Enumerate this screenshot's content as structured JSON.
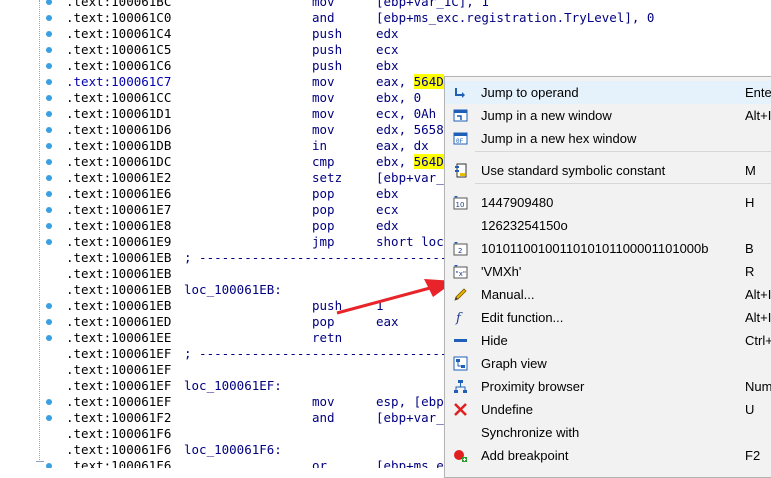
{
  "disasm": {
    "rows": [
      {
        "addr": ".text:100061BC",
        "label": "",
        "mnem": "mov",
        "ops": "[ebp+var_1C], 1",
        "dot": true
      },
      {
        "addr": ".text:100061C0",
        "label": "",
        "mnem": "and",
        "ops": "[ebp+ms_exc.registration.TryLevel], 0",
        "dot": true
      },
      {
        "addr": ".text:100061C4",
        "label": "",
        "mnem": "push",
        "ops": "edx",
        "dot": true
      },
      {
        "addr": ".text:100061C5",
        "label": "",
        "mnem": "push",
        "ops": "ecx",
        "dot": true
      },
      {
        "addr": ".text:100061C6",
        "label": "",
        "mnem": "push",
        "ops": "ebx",
        "dot": true
      },
      {
        "addr": ".text:100061C7",
        "label": "",
        "mnem": "mov",
        "ops": "eax, ",
        "hl": "564D",
        "dot": true,
        "selected": true
      },
      {
        "addr": ".text:100061CC",
        "label": "",
        "mnem": "mov",
        "ops": "ebx, 0",
        "dot": true
      },
      {
        "addr": ".text:100061D1",
        "label": "",
        "mnem": "mov",
        "ops": "ecx, 0Ah",
        "dot": true
      },
      {
        "addr": ".text:100061D6",
        "label": "",
        "mnem": "mov",
        "ops": "edx, 5658",
        "dot": true
      },
      {
        "addr": ".text:100061DB",
        "label": "",
        "mnem": "in",
        "ops": "eax, dx",
        "dot": true
      },
      {
        "addr": ".text:100061DC",
        "label": "",
        "mnem": "cmp",
        "ops": "ebx, ",
        "hl": "564D",
        "dot": true
      },
      {
        "addr": ".text:100061E2",
        "label": "",
        "mnem": "setz",
        "ops": "[ebp+var_",
        "dot": true
      },
      {
        "addr": ".text:100061E6",
        "label": "",
        "mnem": "pop",
        "ops": "ebx",
        "dot": true
      },
      {
        "addr": ".text:100061E7",
        "label": "",
        "mnem": "pop",
        "ops": "ecx",
        "dot": true
      },
      {
        "addr": ".text:100061E8",
        "label": "",
        "mnem": "pop",
        "ops": "edx",
        "dot": true
      },
      {
        "addr": ".text:100061E9",
        "label": "",
        "mnem": "jmp",
        "ops": "short loc",
        "dot": true
      },
      {
        "addr": ".text:100061EB",
        "label": "; ----------------------------------------",
        "mnem": "",
        "ops": "",
        "dot": false
      },
      {
        "addr": ".text:100061EB",
        "label": "",
        "mnem": "",
        "ops": "",
        "dot": false
      },
      {
        "addr": ".text:100061EB",
        "label": "loc_100061EB:",
        "mnem": "",
        "ops": "",
        "dot": false
      },
      {
        "addr": ".text:100061EB",
        "label": "",
        "mnem": "push",
        "ops": "1",
        "dot": true
      },
      {
        "addr": ".text:100061ED",
        "label": "",
        "mnem": "pop",
        "ops": "eax",
        "dot": true
      },
      {
        "addr": ".text:100061EE",
        "label": "",
        "mnem": "retn",
        "ops": "",
        "dot": true
      },
      {
        "addr": ".text:100061EF",
        "label": "; ----------------------------------------",
        "mnem": "",
        "ops": "",
        "dot": false
      },
      {
        "addr": ".text:100061EF",
        "label": "",
        "mnem": "",
        "ops": "",
        "dot": false
      },
      {
        "addr": ".text:100061EF",
        "label": "loc_100061EF:",
        "mnem": "",
        "ops": "",
        "dot": false
      },
      {
        "addr": ".text:100061EF",
        "label": "",
        "mnem": "mov",
        "ops": "esp, [ebp",
        "dot": true
      },
      {
        "addr": ".text:100061F2",
        "label": "",
        "mnem": "and",
        "ops": "[ebp+var_",
        "dot": true
      },
      {
        "addr": ".text:100061F6",
        "label": "",
        "mnem": "",
        "ops": "",
        "dot": false
      },
      {
        "addr": ".text:100061F6",
        "label": "loc_100061F6:",
        "mnem": "",
        "ops": "",
        "dot": false
      },
      {
        "addr": ".text:100061F6",
        "label": "",
        "mnem": "or",
        "ops": "[ebp+ms_e",
        "dot": true
      }
    ]
  },
  "context_menu": {
    "items": [
      {
        "label": "Jump to operand",
        "shortcut": "Ente",
        "icon": "jump-operand-icon"
      },
      {
        "label": "Jump in a new window",
        "shortcut": "Alt+I",
        "icon": "new-window-icon"
      },
      {
        "label": "Jump in a new hex window",
        "shortcut": "",
        "icon": "hex-window-icon"
      },
      {
        "label": "Use standard symbolic constant",
        "shortcut": "M",
        "icon": "symbolic-constant-icon"
      },
      {
        "label": "1447909480",
        "shortcut": "H",
        "icon": "decimal-icon"
      },
      {
        "label": "12623254150o",
        "shortcut": "",
        "icon": "octal-icon"
      },
      {
        "label": "1010110010011010101100001101000b",
        "shortcut": "B",
        "icon": "binary-icon"
      },
      {
        "label": "'VMXh'",
        "shortcut": "R",
        "icon": "char-icon"
      },
      {
        "label": "Manual...",
        "shortcut": "Alt+I",
        "icon": "pencil-icon"
      },
      {
        "label": "Edit function...",
        "shortcut": "Alt+I",
        "icon": "function-icon"
      },
      {
        "label": "Hide",
        "shortcut": "Ctrl+",
        "icon": "hide-icon"
      },
      {
        "label": "Graph view",
        "shortcut": "",
        "icon": "graph-view-icon"
      },
      {
        "label": "Proximity browser",
        "shortcut": "Num",
        "icon": "proximity-icon"
      },
      {
        "label": "Undefine",
        "shortcut": "U",
        "icon": "undefine-icon"
      },
      {
        "label": "Synchronize with",
        "shortcut": "",
        "icon": ""
      },
      {
        "label": "Add breakpoint",
        "shortcut": "F2",
        "icon": "breakpoint-icon"
      }
    ]
  },
  "colors": {
    "highlight": "#ffff00",
    "arrow": "#e8232a",
    "dot": "#3b9fe0"
  }
}
